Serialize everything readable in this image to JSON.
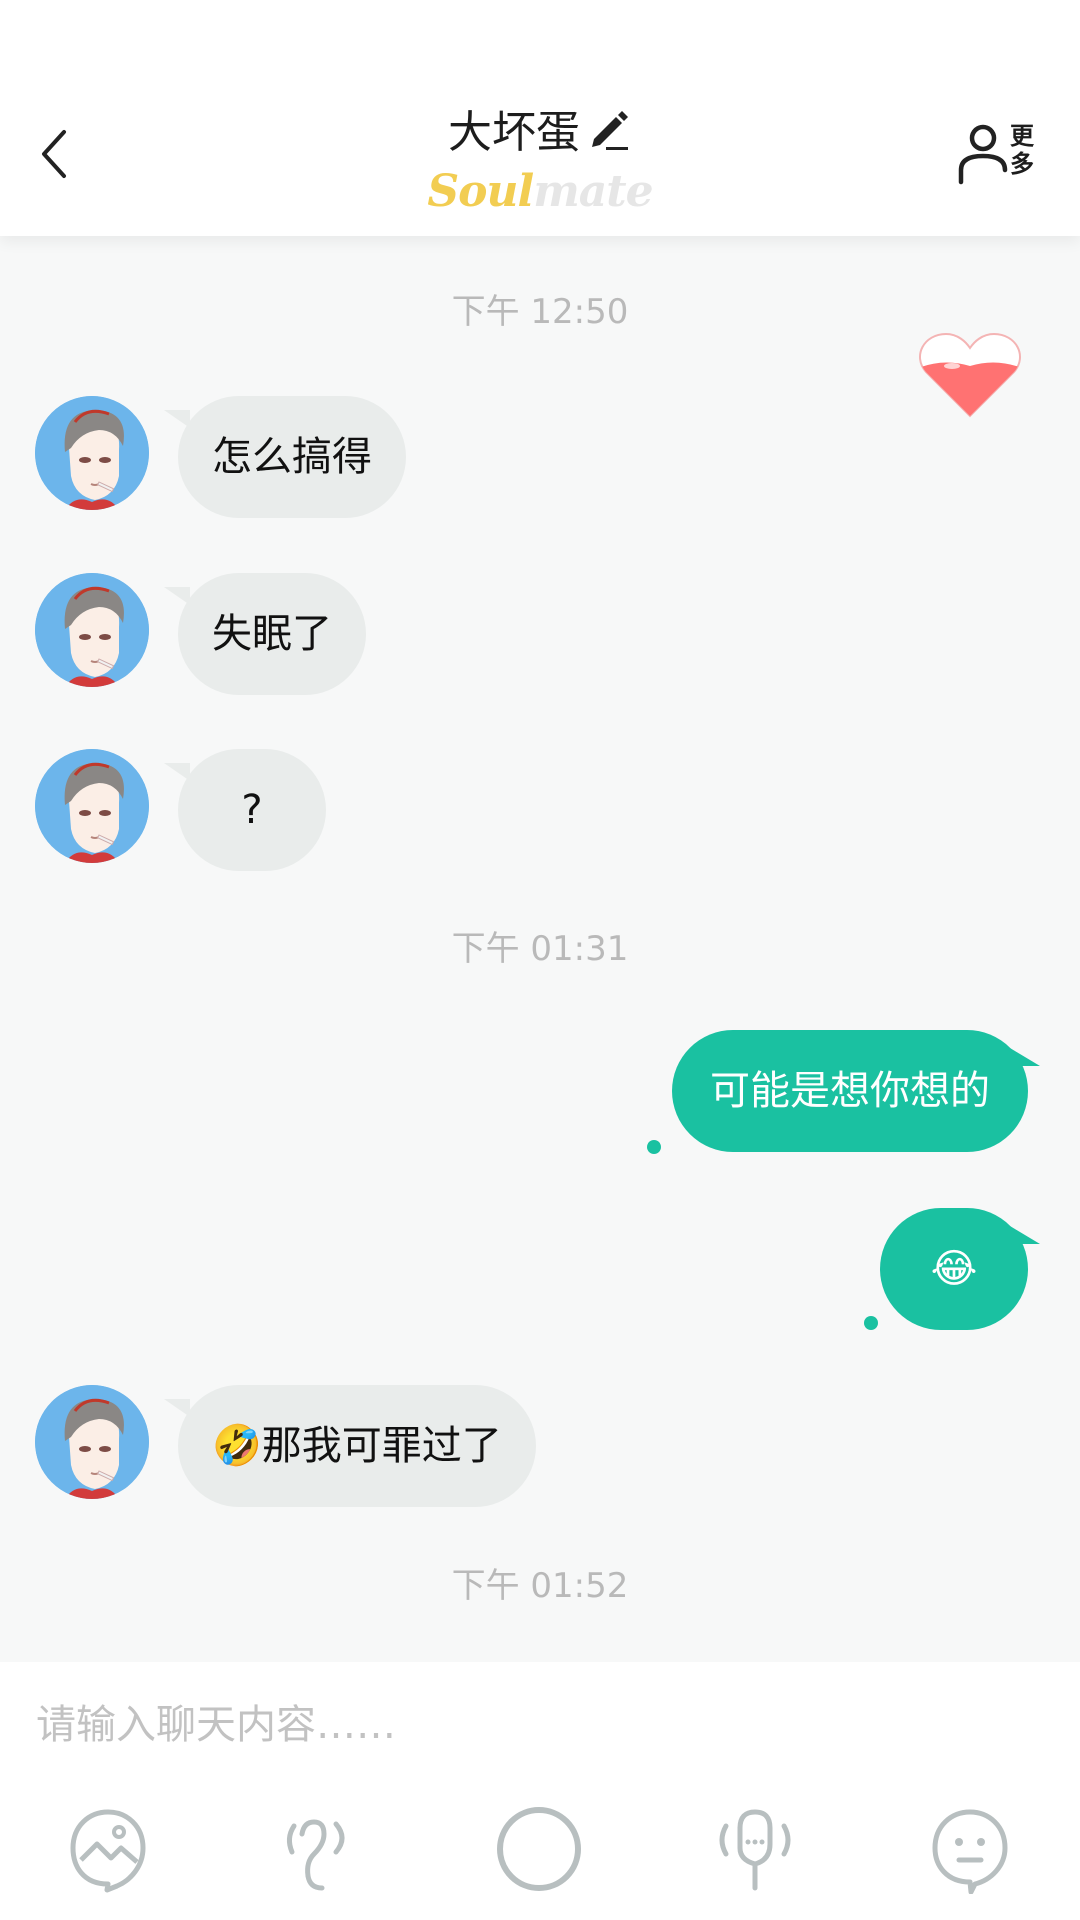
{
  "header": {
    "title": "大坏蛋",
    "brand_part1": "Soul",
    "brand_part2": "mate",
    "more_label": "更多"
  },
  "messages": {
    "ts1": "下午 12:50",
    "m1": "怎么搞得",
    "m2": "失眠了",
    "m3": "?",
    "ts2": "下午 01:31",
    "m4": "可能是想你想的",
    "m5": "😂",
    "m6": "🤣那我可罪过了",
    "ts3": "下午 01:52"
  },
  "input": {
    "placeholder": "请输入聊天内容……"
  },
  "toolbar": {
    "icons": [
      "image-icon",
      "voice-icon",
      "camera-icon",
      "call-icon",
      "emoji-icon"
    ]
  },
  "colors": {
    "accent": "#1ac1a1",
    "incoming_bubble": "#e9eceb",
    "background": "#f7f8f8",
    "brand_yellow": "#f2cd52",
    "heart": "#ff6b6b"
  }
}
